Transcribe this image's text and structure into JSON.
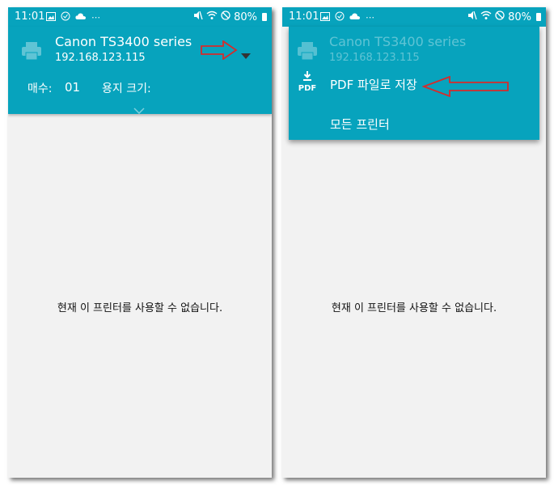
{
  "status_bar": {
    "time": "11:01",
    "battery": "80%"
  },
  "printer": {
    "name": "Canon TS3400 series",
    "ip": "192.168.123.115",
    "copies_label": "매수:",
    "copies_value": "01",
    "paper_size_label": "용지 크기:"
  },
  "dropdown_menu": {
    "items": [
      {
        "label": "PDF 파일로 저장",
        "icon": "pdf-download-icon",
        "icon_text": "PDF"
      },
      {
        "label": "모든 프린터"
      }
    ]
  },
  "message": "현재 이 프린터를 사용할 수 없습니다.",
  "colors": {
    "header": "#07a3bd",
    "body": "#f2f2f2",
    "annotation_arrow": "#d62b2b"
  }
}
